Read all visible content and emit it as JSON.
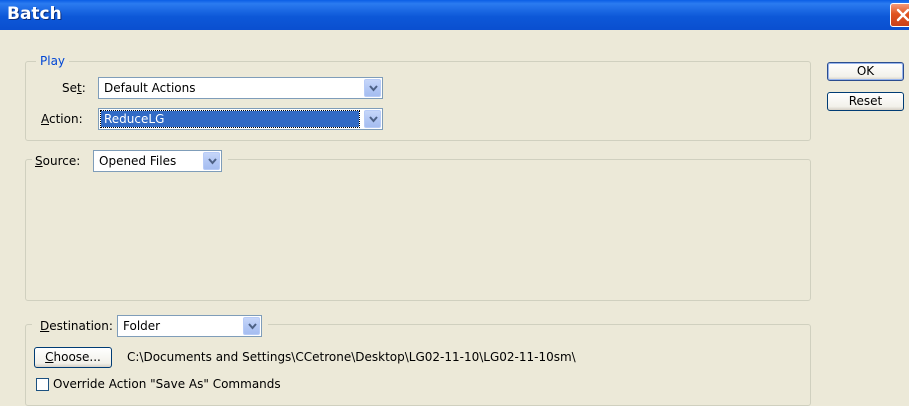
{
  "window": {
    "title": "Batch"
  },
  "play": {
    "legend": "Play",
    "set": {
      "label_before": "Se",
      "label_key": "t",
      "label_after": ":",
      "value": "Default Actions"
    },
    "action": {
      "label_key": "A",
      "label_after": "ction:",
      "value": "ReduceLG"
    }
  },
  "source": {
    "label_key": "S",
    "label_after": "ource:",
    "value": "Opened Files"
  },
  "destination": {
    "label_key": "D",
    "label_after": "estination:",
    "value": "Folder",
    "choose_key": "C",
    "choose_after": "hoose...",
    "path": "C:\\Documents and Settings\\CCetrone\\Desktop\\LG02-11-10\\LG02-11-10sm\\",
    "override_label": "Override Action \"Save As\" Commands"
  },
  "buttons": {
    "ok": "OK",
    "reset": "Reset"
  }
}
